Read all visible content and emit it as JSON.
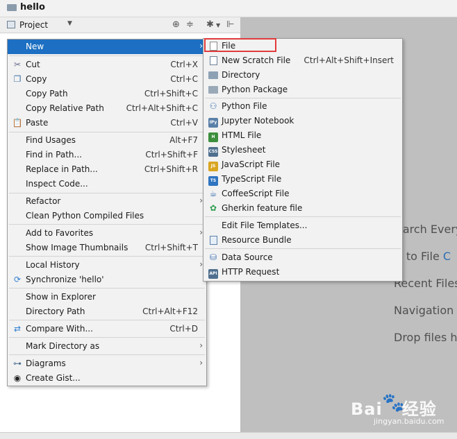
{
  "window": {
    "project_name": "hello"
  },
  "toolbar": {
    "project_label": "Project"
  },
  "editor_hints": [
    {
      "text": "earch Every",
      "accent": ""
    },
    {
      "text": "o to File ",
      "accent": "C"
    },
    {
      "text": "Recent Files",
      "accent": ""
    },
    {
      "text": "Navigation I",
      "accent": ""
    },
    {
      "text": "Drop files he",
      "accent": ""
    }
  ],
  "context_menu": {
    "items": [
      {
        "label": "New",
        "shortcut": "",
        "icon": "none"
      },
      {
        "label": "Cut",
        "shortcut": "Ctrl+X",
        "icon": "scissors-icon"
      },
      {
        "label": "Copy",
        "shortcut": "Ctrl+C",
        "icon": "copy-icon"
      },
      {
        "label": "Copy Path",
        "shortcut": "Ctrl+Shift+C",
        "icon": "none"
      },
      {
        "label": "Copy Relative Path",
        "shortcut": "Ctrl+Alt+Shift+C",
        "icon": "none"
      },
      {
        "label": "Paste",
        "shortcut": "Ctrl+V",
        "icon": "paste-icon"
      },
      {
        "label": "Find Usages",
        "shortcut": "Alt+F7",
        "icon": "none"
      },
      {
        "label": "Find in Path...",
        "shortcut": "Ctrl+Shift+F",
        "icon": "none"
      },
      {
        "label": "Replace in Path...",
        "shortcut": "Ctrl+Shift+R",
        "icon": "none"
      },
      {
        "label": "Inspect Code...",
        "shortcut": "",
        "icon": "none"
      },
      {
        "label": "Refactor",
        "shortcut": "",
        "icon": "none"
      },
      {
        "label": "Clean Python Compiled Files",
        "shortcut": "",
        "icon": "none"
      },
      {
        "label": "Add to Favorites",
        "shortcut": "",
        "icon": "none"
      },
      {
        "label": "Show Image Thumbnails",
        "shortcut": "Ctrl+Shift+T",
        "icon": "none"
      },
      {
        "label": "Local History",
        "shortcut": "",
        "icon": "none"
      },
      {
        "label": "Synchronize 'hello'",
        "shortcut": "",
        "icon": "sync-icon"
      },
      {
        "label": "Show in Explorer",
        "shortcut": "",
        "icon": "none"
      },
      {
        "label": "Directory Path",
        "shortcut": "Ctrl+Alt+F12",
        "icon": "none"
      },
      {
        "label": "Compare With...",
        "shortcut": "Ctrl+D",
        "icon": "compare-icon"
      },
      {
        "label": "Mark Directory as",
        "shortcut": "",
        "icon": "none"
      },
      {
        "label": "Diagrams",
        "shortcut": "",
        "icon": "diagram-icon"
      },
      {
        "label": "Create Gist...",
        "shortcut": "",
        "icon": "github-icon"
      }
    ]
  },
  "new_submenu": {
    "items": [
      {
        "label": "File",
        "shortcut": ""
      },
      {
        "label": "New Scratch File",
        "shortcut": "Ctrl+Alt+Shift+Insert"
      },
      {
        "label": "Directory",
        "shortcut": ""
      },
      {
        "label": "Python Package",
        "shortcut": ""
      },
      {
        "label": "Python File",
        "shortcut": ""
      },
      {
        "label": "Jupyter Notebook",
        "shortcut": ""
      },
      {
        "label": "HTML File",
        "shortcut": ""
      },
      {
        "label": "Stylesheet",
        "shortcut": ""
      },
      {
        "label": "JavaScript File",
        "shortcut": ""
      },
      {
        "label": "TypeScript File",
        "shortcut": ""
      },
      {
        "label": "CoffeeScript File",
        "shortcut": ""
      },
      {
        "label": "Gherkin feature file",
        "shortcut": ""
      },
      {
        "label": "Edit File Templates...",
        "shortcut": ""
      },
      {
        "label": "Resource Bundle",
        "shortcut": ""
      },
      {
        "label": "Data Source",
        "shortcut": ""
      },
      {
        "label": "HTTP Request",
        "shortcut": ""
      }
    ],
    "badges": {
      "jupyter": "IPy",
      "html": "H",
      "css": "CSS",
      "js": "JS",
      "ts": "TS",
      "api": "API"
    }
  },
  "watermark": {
    "brand": "Bai",
    "brand_cn": "经验",
    "domain": "jingyan.baidu.com"
  },
  "colors": {
    "highlight": "#1c6fc2",
    "red_box": "#e23b3b",
    "editor_bg": "#bfbfbf"
  }
}
